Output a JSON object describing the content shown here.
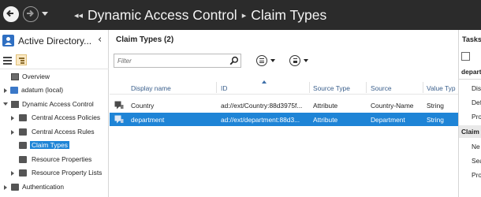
{
  "titlebar": {
    "breadcrumb": [
      "Dynamic Access Control",
      "Claim Types"
    ]
  },
  "left_pane": {
    "title": "Active Directory...",
    "tree": [
      {
        "label": "Overview",
        "icon": "server-icon",
        "expanded": null,
        "selected": false
      },
      {
        "label": "adatum (local)",
        "icon": "domain-icon",
        "expanded": false,
        "selected": false
      },
      {
        "label": "Dynamic Access Control",
        "icon": "dac-icon",
        "expanded": true,
        "selected": false
      },
      {
        "label": "Central Access Policies",
        "icon": "folder-icon",
        "expanded": false,
        "selected": false
      },
      {
        "label": "Central Access Rules",
        "icon": "folder-icon",
        "expanded": false,
        "selected": false
      },
      {
        "label": "Claim Types",
        "icon": "folder-icon",
        "expanded": null,
        "selected": true
      },
      {
        "label": "Resource Properties",
        "icon": "folder-icon",
        "expanded": null,
        "selected": false
      },
      {
        "label": "Resource Property Lists",
        "icon": "folder-icon",
        "expanded": false,
        "selected": false
      },
      {
        "label": "Authentication",
        "icon": "folder-icon",
        "expanded": false,
        "selected": false
      }
    ]
  },
  "center_pane": {
    "title": "Claim Types  (2)",
    "filter_placeholder": "Filter",
    "columns": [
      "Display name",
      "ID",
      "Source Type",
      "Source",
      "Value Typ"
    ],
    "rows": [
      {
        "display_name": "Country",
        "id": "ad://ext/Country:88d3975f...",
        "source_type": "Attribute",
        "source": "Country-Name",
        "value_type": "String",
        "selected": false
      },
      {
        "display_name": "department",
        "id": "ad://ext/department:88d3...",
        "source_type": "Attribute",
        "source": "Department",
        "value_type": "String",
        "selected": true
      }
    ]
  },
  "right_pane": {
    "title": "Tasks",
    "selected_item_header": "depart",
    "items_top": [
      "Dis",
      "Def",
      "Pro"
    ],
    "section_header": "Claim T",
    "items_bottom": [
      "Ne",
      "Sea",
      "Pro"
    ]
  },
  "colors": {
    "titlebar_bg": "#2b2b2b",
    "selection": "#1e84d6",
    "column_header_text": "#3a5f8c"
  }
}
